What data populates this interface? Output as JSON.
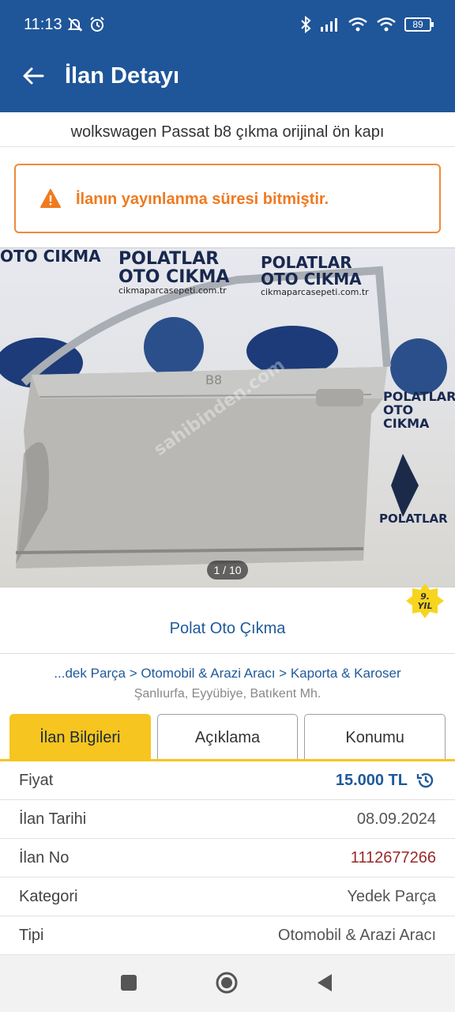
{
  "status_bar": {
    "time": "11:13",
    "battery": "89"
  },
  "app_bar": {
    "title": "İlan Detayı"
  },
  "listing": {
    "title": "wolkswagen Passat b8 çıkma orijinal ön kapı",
    "warning": "İlanın yayınlanma süresi bitmiştir.",
    "photo_counter": "1 / 10",
    "photo_logos": {
      "brand1": "POLATLAR",
      "brand2": "OTO CIKMA",
      "site": "cikmaparcasepeti.com.tr",
      "watermark": "sahibinden.com"
    },
    "years_badge": "9. YIL",
    "seller": "Polat Oto Çıkma",
    "breadcrumb": "...dek Parça > Otomobil & Arazi Aracı > Kaporta & Karoser",
    "location": "Şanlıurfa, Eyyübiye, Batıkent Mh."
  },
  "tabs": [
    {
      "label": "İlan Bilgileri",
      "active": true
    },
    {
      "label": "Açıklama",
      "active": false
    },
    {
      "label": "Konumu",
      "active": false
    }
  ],
  "info": {
    "price_label": "Fiyat",
    "price_value": "15.000 TL",
    "date_label": "İlan Tarihi",
    "date_value": "08.09.2024",
    "no_label": "İlan No",
    "no_value": "1112677266",
    "category_label": "Kategori",
    "category_value": "Yedek Parça",
    "type_label": "Tipi",
    "type_value": "Otomobil & Arazi Aracı"
  },
  "colors": {
    "primary": "#1f5699",
    "accent": "#f7c51f",
    "warning": "#f08a3a"
  },
  "icons": [
    "back-arrow-icon",
    "warning-icon",
    "history-icon",
    "nav-recents-icon",
    "nav-home-icon",
    "nav-back-icon"
  ]
}
